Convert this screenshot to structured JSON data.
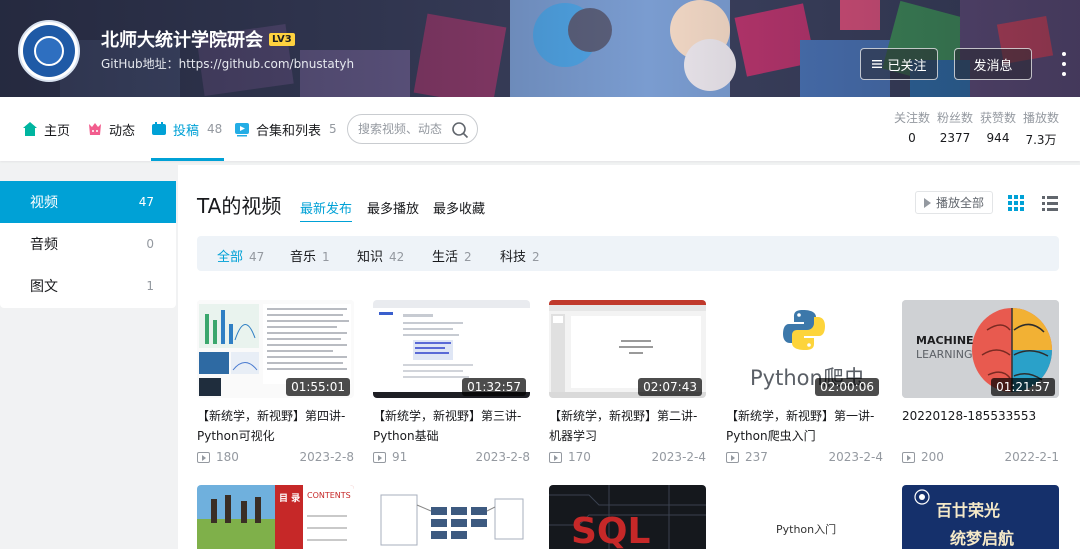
{
  "header": {
    "username": "北师大统计学院研会",
    "level": "LV3",
    "signature": "GitHub地址：https://github.com/bnustatyh",
    "followed_label": "已关注",
    "message_label": "发消息"
  },
  "nav": {
    "items": [
      {
        "label": "主页",
        "count": ""
      },
      {
        "label": "动态",
        "count": ""
      },
      {
        "label": "投稿",
        "count": "48"
      },
      {
        "label": "合集和列表",
        "count": "5"
      }
    ],
    "search_placeholder": "搜索视频、动态",
    "stats": [
      {
        "label": "关注数",
        "value": "0"
      },
      {
        "label": "粉丝数",
        "value": "2377"
      },
      {
        "label": "获赞数",
        "value": "944"
      },
      {
        "label": "播放数",
        "value": "7.3万"
      }
    ]
  },
  "sidebar": {
    "items": [
      {
        "label": "视频",
        "count": "47"
      },
      {
        "label": "音频",
        "count": "0"
      },
      {
        "label": "图文",
        "count": "1"
      }
    ]
  },
  "main": {
    "title": "TA的视频",
    "sort_tabs": [
      "最新发布",
      "最多播放",
      "最多收藏"
    ],
    "play_all": "播放全部",
    "filters": [
      {
        "label": "全部",
        "count": "47"
      },
      {
        "label": "音乐",
        "count": "1"
      },
      {
        "label": "知识",
        "count": "42"
      },
      {
        "label": "生活",
        "count": "2"
      },
      {
        "label": "科技",
        "count": "2"
      }
    ],
    "videos": [
      {
        "title": "【新统学，新视野】第四讲-Python可视化",
        "duration": "01:55:01",
        "plays": "180",
        "date": "2023-2-8"
      },
      {
        "title": "【新统学，新视野】第三讲-Python基础",
        "duration": "01:32:57",
        "plays": "91",
        "date": "2023-2-8"
      },
      {
        "title": "【新统学，新视野】第二讲-机器学习",
        "duration": "02:07:43",
        "plays": "170",
        "date": "2023-2-4"
      },
      {
        "title": "【新统学，新视野】第一讲-Python爬虫入门",
        "duration": "02:00:06",
        "plays": "237",
        "date": "2023-2-4"
      },
      {
        "title": "20220128-185533553",
        "duration": "01:21:57",
        "plays": "200",
        "date": "2022-2-1"
      }
    ],
    "thumb_texts": {
      "python_crawler": "Python爬虫",
      "machine": "MACHINE",
      "learning": "LEARNING",
      "contents_cn": "目 录",
      "contents_en": "CONTENTS",
      "python_intro": "Python入门",
      "glory_line1": "百廿荣光",
      "glory_line2": "统梦启航"
    }
  },
  "colors": {
    "accent": "#00a1d6",
    "text": "#18191c",
    "muted": "#9499a0",
    "level_badge": "#ffd23f"
  }
}
